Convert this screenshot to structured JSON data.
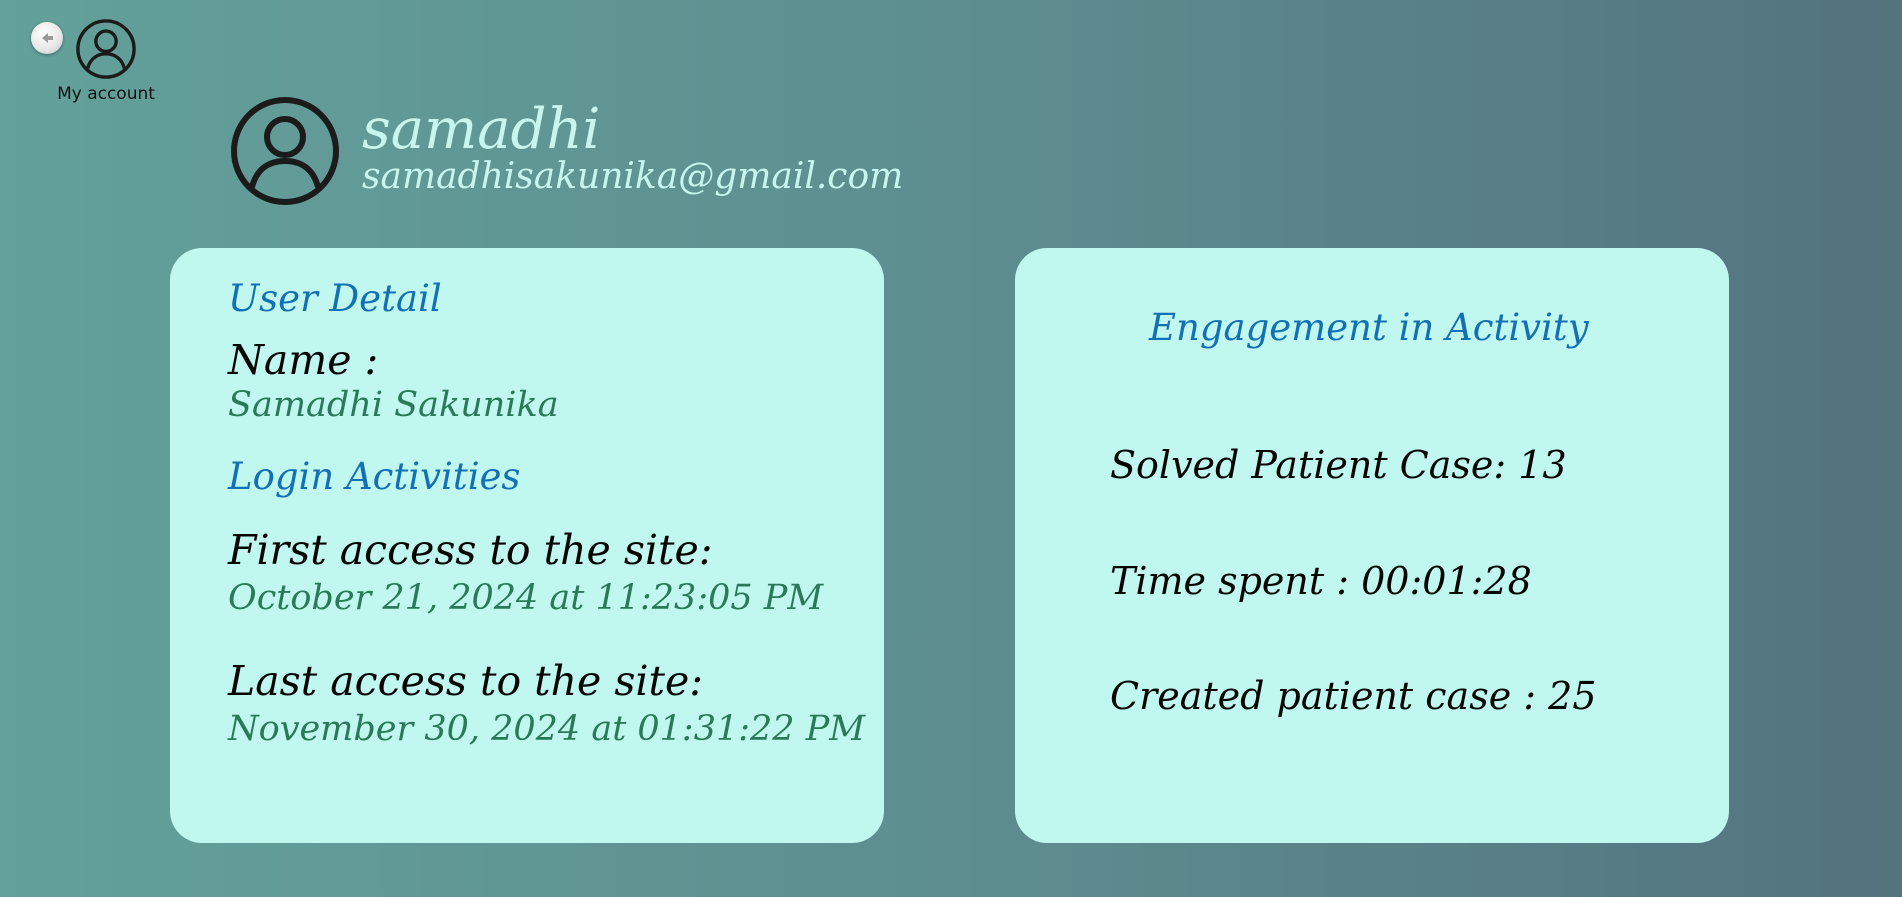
{
  "header": {
    "back_button": {
      "icon": "arrow-left-icon"
    },
    "account": {
      "label": "My account",
      "icon": "user-circle-icon"
    }
  },
  "profile": {
    "username": "samadhi",
    "email": "samadhisakunika@gmail.com",
    "avatar_icon": "user-circle-icon"
  },
  "user_detail": {
    "title": "User Detail",
    "name_label": "Name :",
    "name_value": "Samadhi Sakunika",
    "login_title": "Login Activities",
    "first_access_label": "First access to the site:",
    "first_access_value": "October 21, 2024 at 11:23:05 PM",
    "last_access_label": "Last access to the site:",
    "last_access_value": "November 30, 2024 at 01:31:22 PM"
  },
  "engagement": {
    "title": "Engagement in Activity",
    "stats": [
      "Solved Patient Case: 13",
      "Time spent : 00:01:28",
      "Created patient case : 25"
    ]
  },
  "colors": {
    "card_background": "#c0f7ef",
    "heading_blue": "#1270b5",
    "value_green": "#2a7a5a",
    "profile_text": "#c6f6ee"
  }
}
